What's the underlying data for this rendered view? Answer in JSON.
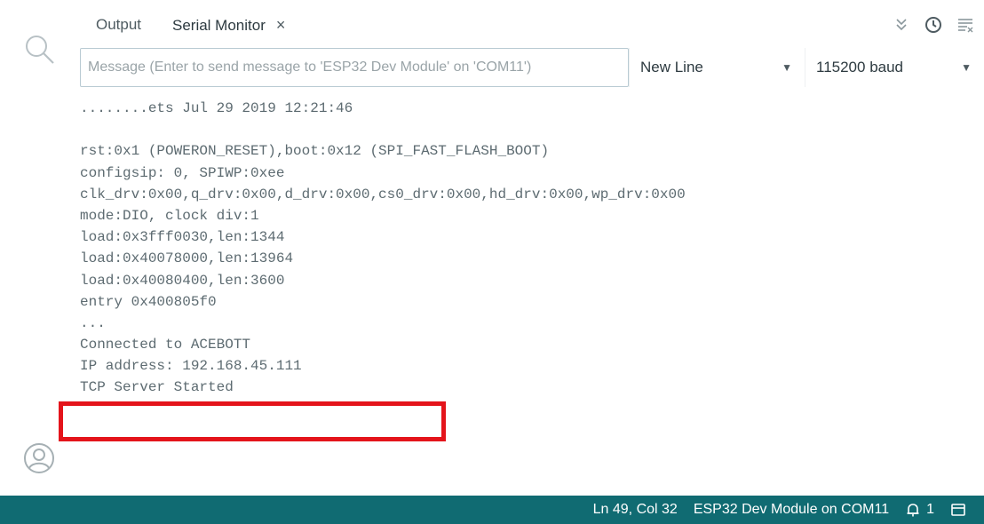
{
  "tabs": {
    "output_label": "Output",
    "serial_label": "Serial Monitor",
    "close_glyph": "×"
  },
  "toolbar_icons": [
    "toggle-autoscroll-icon",
    "timestamp-clock-icon",
    "clear-output-icon"
  ],
  "message": {
    "placeholder": "Message (Enter to send message to 'ESP32 Dev Module' on 'COM11')",
    "value": ""
  },
  "line_ending": {
    "selected": "New Line"
  },
  "baud_rate": {
    "selected": "115200 baud"
  },
  "console_lines": [
    "........ets Jul 29 2019 12:21:46",
    "",
    "rst:0x1 (POWERON_RESET),boot:0x12 (SPI_FAST_FLASH_BOOT)",
    "configsip: 0, SPIWP:0xee",
    "clk_drv:0x00,q_drv:0x00,d_drv:0x00,cs0_drv:0x00,hd_drv:0x00,wp_drv:0x00",
    "mode:DIO, clock div:1",
    "load:0x3fff0030,len:1344",
    "load:0x40078000,len:13964",
    "load:0x40080400,len:3600",
    "entry 0x400805f0",
    "...",
    "Connected to ACEBOTT",
    "IP address: 192.168.45.111",
    "TCP Server Started"
  ],
  "highlight_color": "#e4141b",
  "statusbar": {
    "position": "Ln 49, Col 32",
    "board": "ESP32 Dev Module on COM11",
    "notifications": "1",
    "background": "#106b72"
  }
}
